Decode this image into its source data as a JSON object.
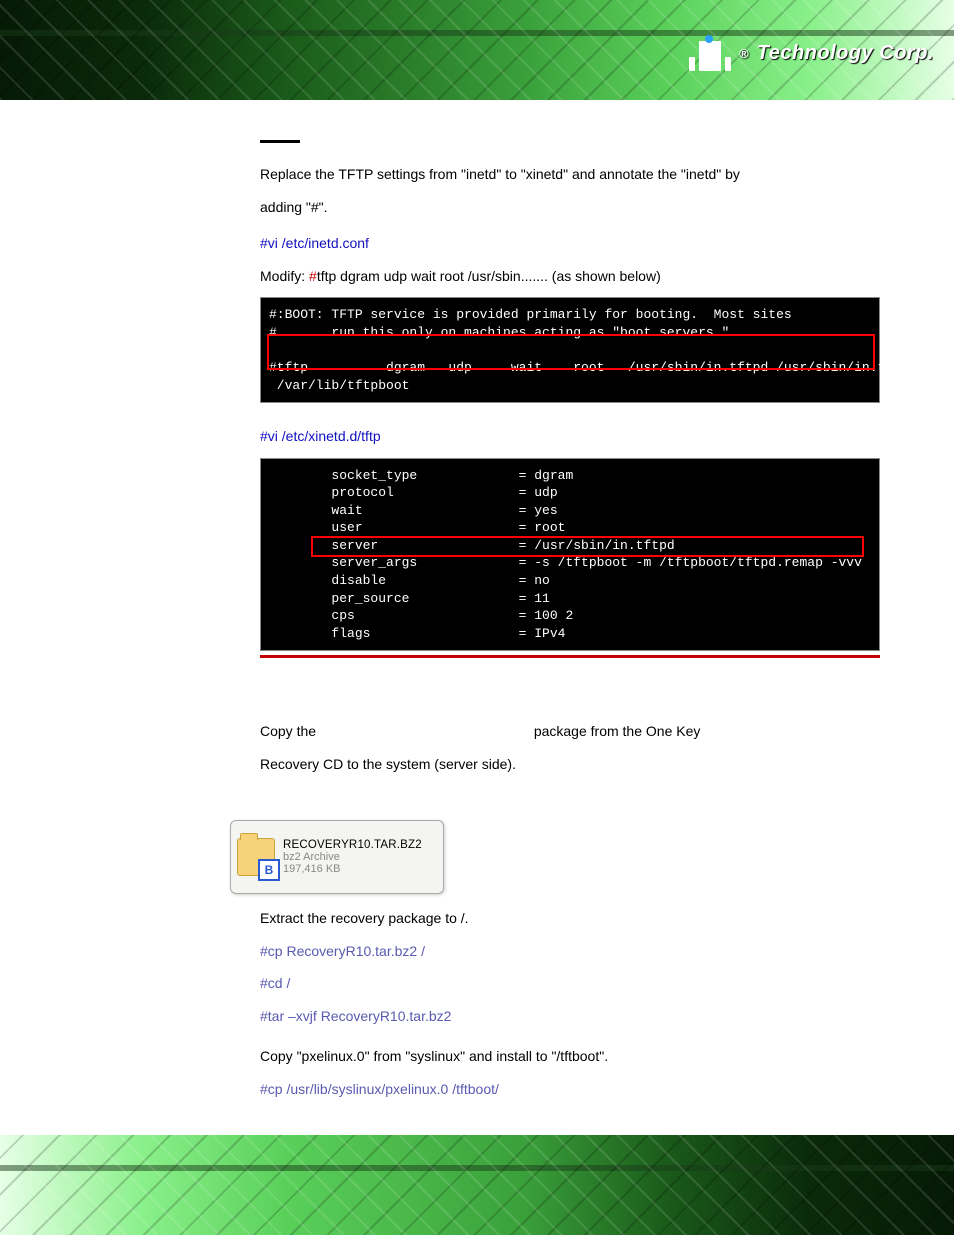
{
  "header": {
    "brand_symbol": "®",
    "brand_text": "Technology Corp."
  },
  "step15": {
    "intro_line1": "Replace the TFTP settings from \"inetd\" to \"xinetd\" and annotate the \"inetd\" by",
    "intro_line2": "adding \"#\".",
    "cmd1": "#vi /etc/inetd.conf",
    "modify_prefix": "Modify: ",
    "modify_hash": "#",
    "modify_rest": "tftp dgram udp wait root /usr/sbin....... (as shown below)",
    "terminal1": "#:BOOT: TFTP service is provided primarily for booting.  Most sites\n#       run this only on machines acting as \"boot servers.\"\n\n#tftp          dgram   udp     wait    root   /usr/sbin/in.tftpd /usr/sbin/in.tftpd -s\n /var/lib/tftpboot",
    "cmd2": "#vi /etc/xinetd.d/tftp",
    "terminal2": "        socket_type             = dgram\n        protocol                = udp\n        wait                    = yes\n        user                    = root\n        server                  = /usr/sbin/in.tftpd\n        server_args             = -s /tftpboot -m /tftpboot/tftpd.remap -vvv\n        disable                 = no\n        per_source              = 11\n        cps                     = 100 2\n        flags                   = IPv4"
  },
  "section_b4": {
    "copy_sentence_part1": "Copy the ",
    "copy_sentence_part2": "package from the One Key",
    "copy_sentence_line2": "Recovery CD to the system (server side)."
  },
  "file": {
    "name": "RECOVERYR10.TAR.BZ2",
    "type": "bz2 Archive",
    "size": "197,416 KB",
    "badge": "B"
  },
  "step17": {
    "intro": "Extract the recovery package to /.",
    "cmd1": "#cp RecoveryR10.tar.bz2 /",
    "cmd2": "#cd /",
    "cmd3": "#tar –xvjf RecoveryR10.tar.bz2"
  },
  "step18": {
    "intro": "Copy \"pxelinux.0\" from \"syslinux\" and install to \"/tftboot\".",
    "cmd1": "#cp /usr/lib/syslinux/pxelinux.0 /tftboot/"
  }
}
